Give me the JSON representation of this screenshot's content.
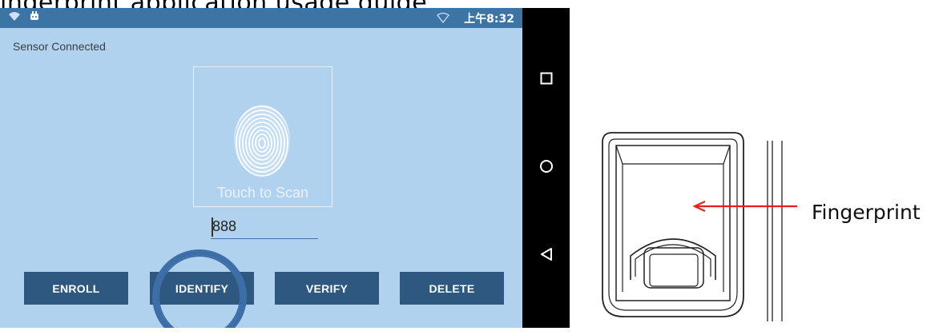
{
  "heading_fragment": "ingerprint application usage guide",
  "status_bar": {
    "time": "上午8:32",
    "icons": [
      "wifi-icon",
      "android-icon",
      "signal-icon"
    ]
  },
  "app": {
    "sensor_status": "Sensor Connected",
    "scan_label": "Touch to Scan",
    "id_value": "888",
    "buttons": {
      "enroll": "ENROLL",
      "identify": "IDENTIFY",
      "verify": "VERIFY",
      "delete": "DELETE"
    },
    "button_color": "#2e5880",
    "screen_bg": "#b1d2ef",
    "highlight_color": "#3d6ea7"
  },
  "nav_bar": {
    "icons": [
      "square-icon",
      "circle-icon",
      "back-triangle-icon"
    ]
  },
  "device_diagram": {
    "callout_label": "Fingerprint",
    "arrow_color": "#e3211b"
  }
}
